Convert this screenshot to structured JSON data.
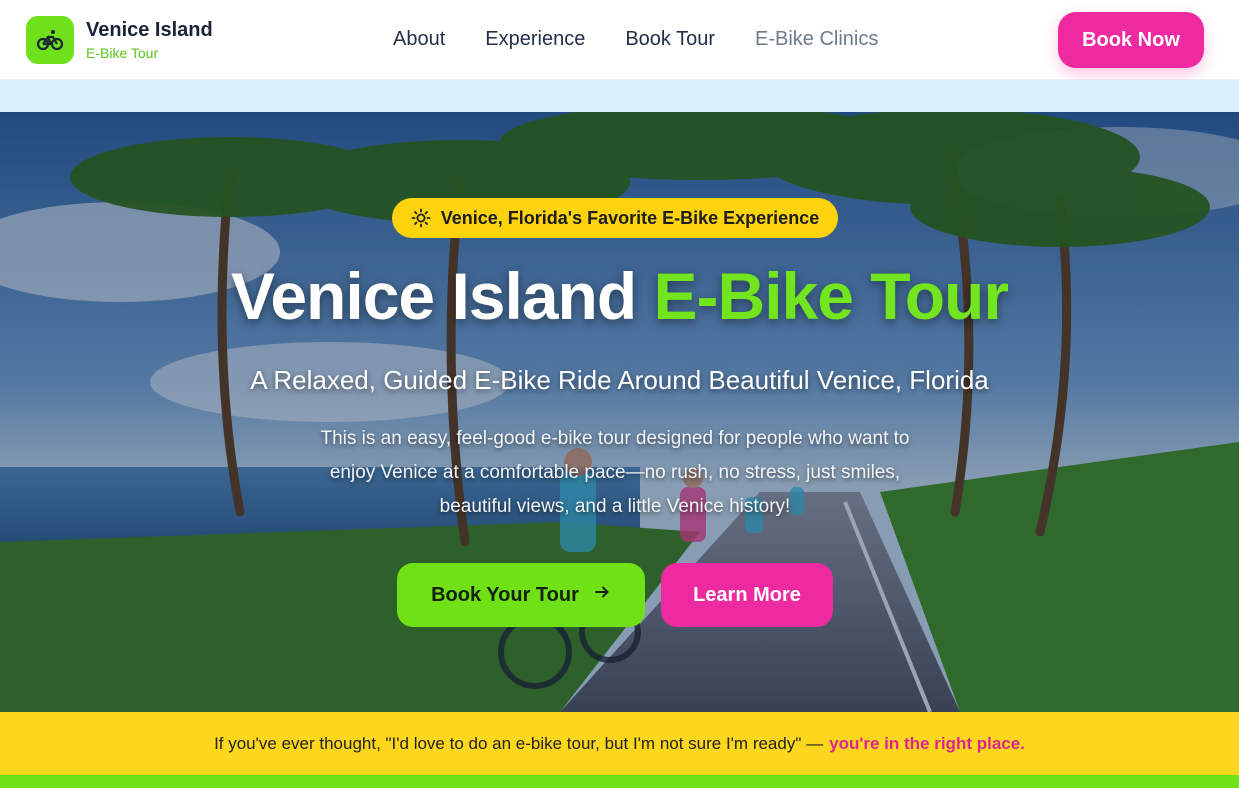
{
  "brand": {
    "title": "Venice Island",
    "subtitle": "E-Bike Tour",
    "logo_icon": "bicycle-icon"
  },
  "nav": {
    "items": [
      {
        "label": "About"
      },
      {
        "label": "Experience"
      },
      {
        "label": "Book Tour"
      },
      {
        "label": "E-Bike Clinics"
      }
    ],
    "cta_label": "Book Now"
  },
  "hero": {
    "badge": "Venice, Florida's Favorite E-Bike Experience",
    "badge_icon": "sun-icon",
    "title_main": "Venice Island",
    "title_accent": "E-Bike Tour",
    "subtitle": "A Relaxed, Guided E-Bike Ride Around Beautiful Venice, Florida",
    "description": "This is an easy, feel-good e-bike tour designed for people who want to enjoy Venice at a comfortable pace—no rush, no stress, just smiles, beautiful views, and a little Venice history!",
    "primary_button": "Book Your Tour",
    "primary_button_icon": "arrow-right-icon",
    "secondary_button": "Learn More"
  },
  "banner": {
    "text": "If you've ever thought, \"I'd love to do an e-bike tour, but I'm not sure I'm ready\" —",
    "highlight": "you're in the right place."
  },
  "colors": {
    "brand_green": "#6fe116",
    "brand_pink": "#ee2aa0",
    "badge_yellow": "#fdd30e",
    "navy_text": "#1b2435"
  }
}
